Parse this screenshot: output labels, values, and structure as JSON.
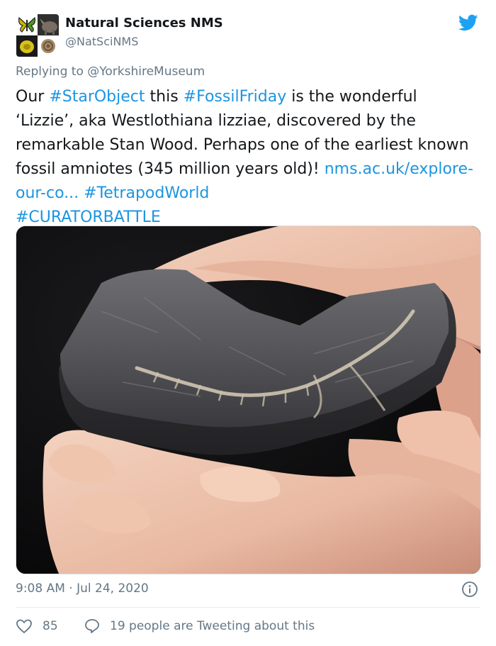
{
  "account": {
    "name": "Natural Sciences NMS",
    "handle": "@NatSciNMS"
  },
  "reply": {
    "prefix": "Replying to ",
    "to": "@YorkshireMuseum"
  },
  "tweet": {
    "t1": "Our ",
    "tag1": "#StarObject",
    "t2": " this ",
    "tag2": "#FossilFriday",
    "t3": " is the wonderful ‘Lizzie’, aka Westlothiana lizziae, discovered by the remarkable Stan Wood. Perhaps one of the earliest known fossil amniotes (345 million years old)! ",
    "link": "nms.ac.uk/explore-our-co...",
    "t4": " ",
    "tag3": "#TetrapodWorld",
    "t5": " ",
    "tag4": "#CURATORBATTLE"
  },
  "meta": {
    "timestamp": "9:08 AM · Jul 24, 2020",
    "likes": "85",
    "tweeting": "19 people are Tweeting about this"
  },
  "colors": {
    "link": "#1b95e0",
    "muted": "#657786",
    "twitter_blue": "#1da1f2"
  },
  "icons": [
    "twitter-bird-icon",
    "info-icon",
    "heart-icon",
    "speech-bubble-icon"
  ]
}
